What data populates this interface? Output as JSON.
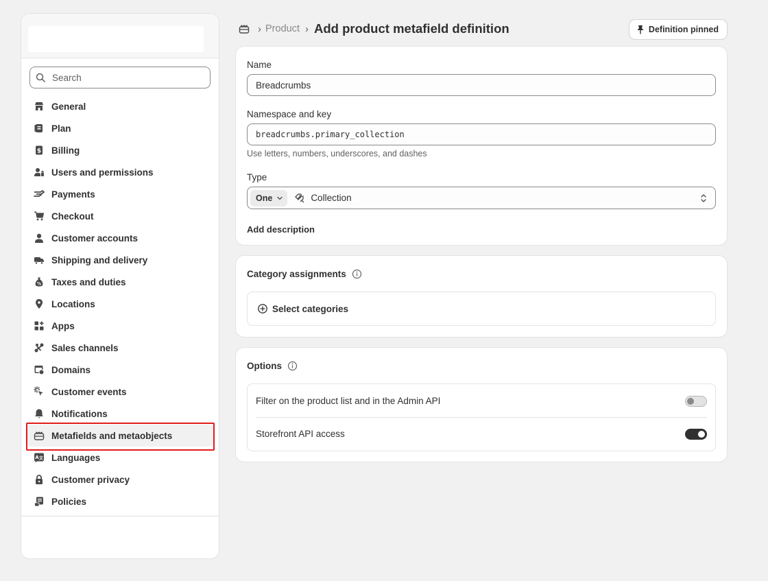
{
  "sidebar": {
    "search_placeholder": "Search",
    "items": [
      {
        "label": "General",
        "icon": "store-icon"
      },
      {
        "label": "Plan",
        "icon": "plan-icon"
      },
      {
        "label": "Billing",
        "icon": "billing-icon"
      },
      {
        "label": "Users and permissions",
        "icon": "users-icon"
      },
      {
        "label": "Payments",
        "icon": "payments-icon"
      },
      {
        "label": "Checkout",
        "icon": "cart-icon"
      },
      {
        "label": "Customer accounts",
        "icon": "person-icon"
      },
      {
        "label": "Shipping and delivery",
        "icon": "truck-icon"
      },
      {
        "label": "Taxes and duties",
        "icon": "tax-icon"
      },
      {
        "label": "Locations",
        "icon": "location-pin-icon"
      },
      {
        "label": "Apps",
        "icon": "apps-icon"
      },
      {
        "label": "Sales channels",
        "icon": "sales-channels-icon"
      },
      {
        "label": "Domains",
        "icon": "globe-icon"
      },
      {
        "label": "Customer events",
        "icon": "cursor-sparkle-icon"
      },
      {
        "label": "Notifications",
        "icon": "bell-icon"
      },
      {
        "label": "Metafields and metaobjects",
        "icon": "metafields-icon",
        "active": true
      },
      {
        "label": "Languages",
        "icon": "language-icon"
      },
      {
        "label": "Customer privacy",
        "icon": "lock-icon"
      },
      {
        "label": "Policies",
        "icon": "policy-icon"
      }
    ]
  },
  "header": {
    "breadcrumb_parent": "Product",
    "breadcrumb_sep": "›",
    "title": "Add product metafield definition",
    "pin_button": "Definition pinned"
  },
  "definition": {
    "name_label": "Name",
    "name_value": "Breadcrumbs",
    "ns_label": "Namespace and key",
    "ns_value": "breadcrumbs.primary_collection",
    "ns_help": "Use letters, numbers, underscores, and dashes",
    "type_label": "Type",
    "type_cardinality": "One",
    "type_value": "Collection",
    "add_description": "Add description"
  },
  "category": {
    "title": "Category assignments",
    "select_label": "Select categories"
  },
  "options": {
    "title": "Options",
    "rows": [
      {
        "label": "Filter on the product list and in the Admin API",
        "enabled": false
      },
      {
        "label": "Storefront API access",
        "enabled": true
      }
    ]
  }
}
